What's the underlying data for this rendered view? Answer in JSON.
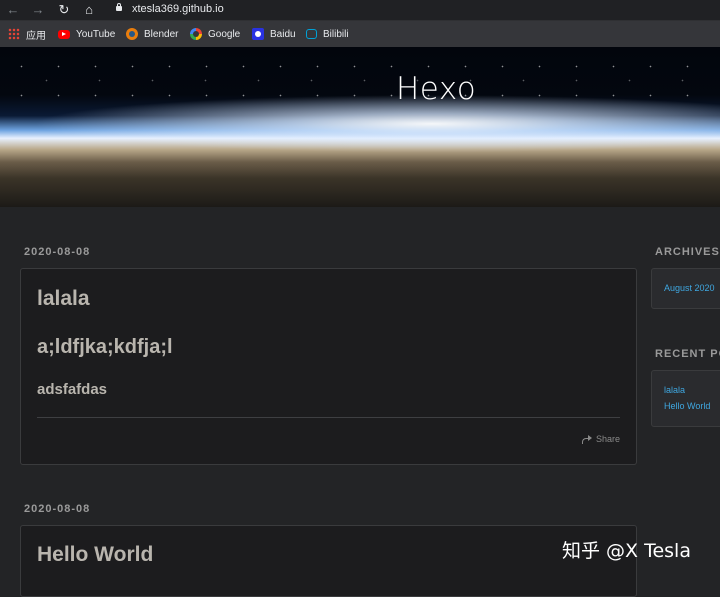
{
  "browser": {
    "back_label": "←",
    "forward_label": "→",
    "reload_label": "↻",
    "home_label": "⌂",
    "url": "xtesla369.github.io"
  },
  "bookmarks": [
    {
      "label": "应用",
      "icon": "apps-icon"
    },
    {
      "label": "YouTube",
      "icon": "youtube-icon"
    },
    {
      "label": "Blender",
      "icon": "blender-icon"
    },
    {
      "label": "Google",
      "icon": "google-icon"
    },
    {
      "label": "Baidu",
      "icon": "baidu-icon"
    },
    {
      "label": "Bilibili",
      "icon": "bilibili-icon"
    }
  ],
  "site": {
    "title": "Hexo"
  },
  "posts": [
    {
      "date": "2020-08-08",
      "title": "lalala",
      "heading2": "a;ldfjka;kdfja;l",
      "heading3": "adsfafdas",
      "share_label": "Share"
    },
    {
      "date": "2020-08-08",
      "title": "Hello World"
    }
  ],
  "sidebar": {
    "archives_title": "ARCHIVES",
    "archives": [
      "August 2020"
    ],
    "recent_title": "RECENT POSTS",
    "recent": [
      "lalala",
      "Hello World"
    ]
  },
  "watermark": "知乎 @X Tesla",
  "colors": {
    "link": "#3fa7e0",
    "background": "#232426",
    "card": "#1c1c1e"
  }
}
